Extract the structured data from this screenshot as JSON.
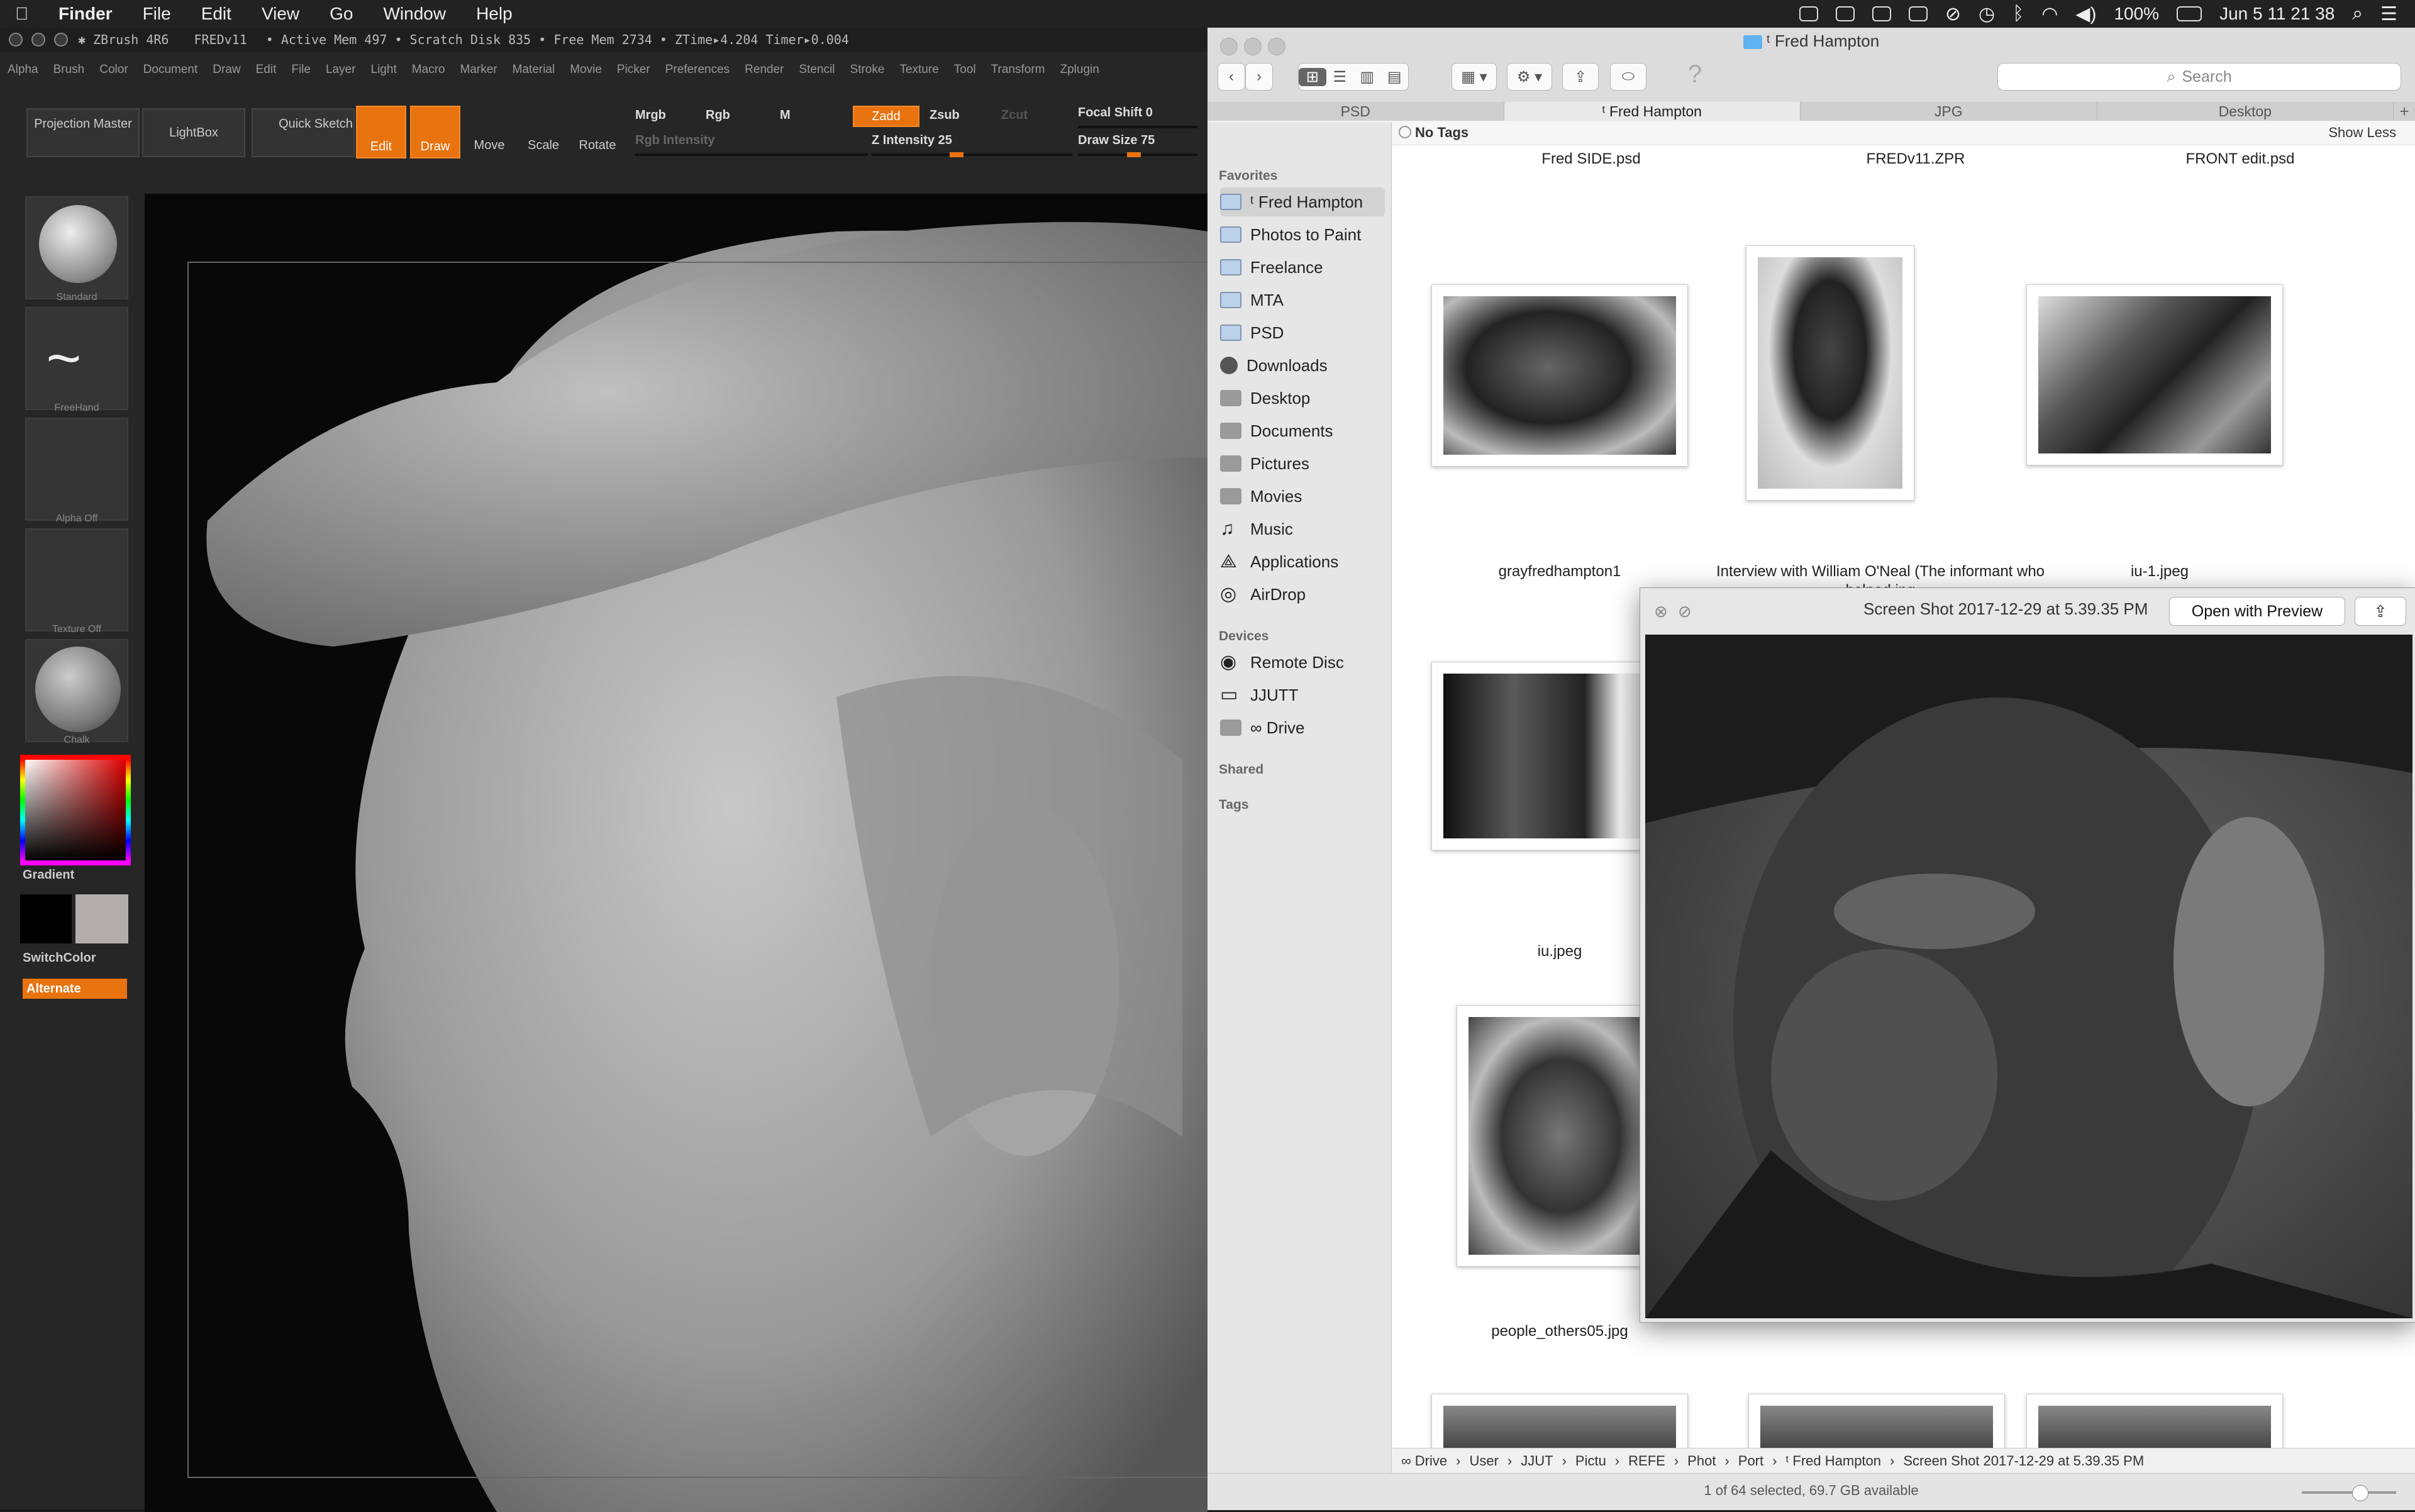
{
  "menubar": {
    "app": "Finder",
    "items": [
      "File",
      "Edit",
      "View",
      "Go",
      "Window",
      "Help"
    ],
    "battery": "100%",
    "datetime": "Jun 5  11 21 38"
  },
  "zbrush": {
    "title": "ZBrush 4R6",
    "doc": "FREDv11",
    "stats": "• Active Mem 497 • Scratch Disk 835 • Free Mem 2734 • ZTime▸4.204 Timer▸0.004",
    "menus": [
      "Alpha",
      "Brush",
      "Color",
      "Document",
      "Draw",
      "Edit",
      "File",
      "Layer",
      "Light",
      "Macro",
      "Marker",
      "Material",
      "Movie",
      "Picker",
      "Preferences",
      "Render",
      "Stencil",
      "Stroke",
      "Texture",
      "Tool",
      "Transform",
      "Zplugin"
    ],
    "toolbar": {
      "projection_master": "Projection Master",
      "lightbox": "LightBox",
      "quick_sketch": "Quick Sketch",
      "edit": "Edit",
      "draw": "Draw",
      "move": "Move",
      "scale": "Scale",
      "rotate": "Rotate",
      "mrgb": "Mrgb",
      "rgb": "Rgb",
      "m": "M",
      "rgb_intensity": "Rgb Intensity",
      "zadd": "Zadd",
      "zsub": "Zsub",
      "zcut": "Zcut",
      "z_intensity": "Z Intensity 25",
      "focal_shift": "Focal Shift 0",
      "draw_size": "Draw Size 75"
    },
    "sidebar": {
      "standard": "Standard",
      "freehand": "FreeHand",
      "alpha": "Alpha Off",
      "texture": "Texture Off",
      "material": "Chalk",
      "gradient": "Gradient",
      "switchcolor": "SwitchColor",
      "alternate": "Alternate"
    },
    "colors": {
      "accent": "#e8730f"
    }
  },
  "finder": {
    "window_title": "ᵗ Fred Hampton",
    "search_placeholder": "Search",
    "tabs": [
      "PSD",
      "ᵗ Fred Hampton",
      "JPG",
      "Desktop"
    ],
    "tags_label": "No Tags",
    "show_less": "Show Less",
    "sidebar": {
      "favorites_header": "Favorites",
      "favorites": [
        "ᵗ Fred Hampton",
        "Photos to Paint",
        "Freelance",
        "MTA",
        "PSD",
        "Downloads",
        "Desktop",
        "Documents",
        "Pictures",
        "Movies",
        "Music",
        "Applications",
        "AirDrop"
      ],
      "devices_header": "Devices",
      "devices": [
        "Remote Disc",
        "JJUTT",
        "∞ Drive"
      ],
      "shared_header": "Shared",
      "tags_header": "Tags"
    },
    "files_top": [
      "Fred SIDE.psd",
      "FREDv11.ZPR",
      "FRONT edit.psd"
    ],
    "files": [
      {
        "name": "grayfredhampton1"
      },
      {
        "name": "Interview with William O'Neal (The informant who helped.jpg"
      },
      {
        "name": "iu-1.jpeg"
      },
      {
        "name": "iu.jpeg"
      },
      {
        "name": "people_others05.jpg"
      }
    ],
    "path": [
      "∞ Drive",
      "User",
      "JJUT",
      "Pictu",
      "REFE",
      "Phot",
      "Port",
      "ᵗ Fred Hampton",
      "Screen Shot 2017-12-29 at 5.39.35 PM"
    ],
    "status": "1 of 64 selected, 69.7 GB available"
  },
  "quicklook": {
    "title": "Screen Shot 2017-12-29 at 5.39.35 PM",
    "open_with": "Open with Preview"
  }
}
